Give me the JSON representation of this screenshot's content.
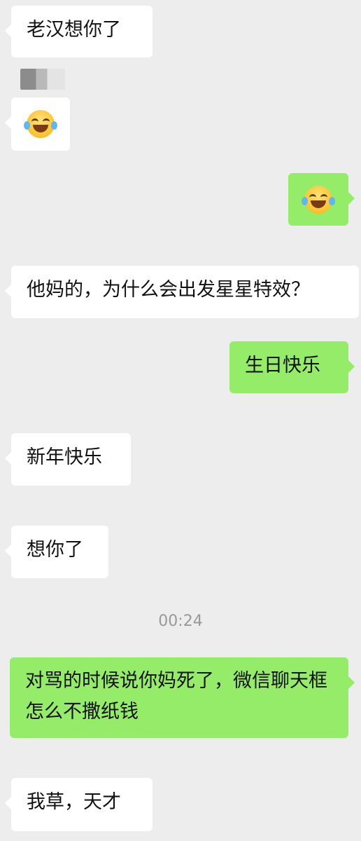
{
  "messages": [
    {
      "side": "left",
      "text": "老汉想你了"
    },
    {
      "side": "left",
      "type": "emoji",
      "icon": "laugh-tears-emoji"
    },
    {
      "side": "right",
      "type": "emoji",
      "icon": "laugh-tears-emoji"
    },
    {
      "side": "left",
      "text": "他妈的，为什么会出发星星特效？"
    },
    {
      "side": "right",
      "text": "生日快乐"
    },
    {
      "side": "left",
      "text": "新年快乐"
    },
    {
      "side": "left",
      "text": "想你了"
    },
    {
      "side": "right",
      "text": "对骂的时候说你妈死了，微信聊天框怎么不撒纸钱"
    },
    {
      "side": "left",
      "text": "我草，天才"
    }
  ],
  "timestamp": "00:24",
  "colors": {
    "background": "#ededed",
    "incoming": "#ffffff",
    "outgoing": "#95ec69",
    "timestamp": "#999999"
  }
}
